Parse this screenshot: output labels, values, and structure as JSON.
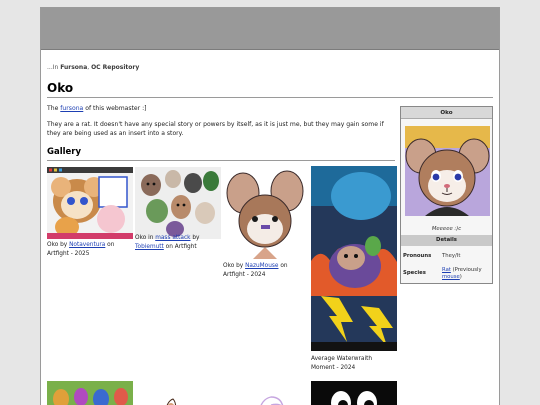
{
  "breadcrumb": {
    "prefix": "...In ",
    "link1": "Fursona",
    "sep": ", ",
    "link2": "OC Repository"
  },
  "page": {
    "title": "Oko",
    "intro_pre": "The ",
    "intro_link": "fursona",
    "intro_post": " of this webmaster :]",
    "description": "They are a rat. It doesn't have any special story or powers by itself, as it is just me, but they may gain some if they are being used as an insert into a story."
  },
  "gallery": {
    "heading": "Gallery",
    "items": [
      {
        "pre": "Oko by ",
        "link": "Notaventura",
        "post": " on Artfight - 2025"
      },
      {
        "pre": "Oko in ",
        "link": "mass attack",
        "mid": " by ",
        "link2": "Tobiemutt",
        "post": " on Artfight"
      },
      {
        "pre": "Oko by ",
        "link": "NazuMouse",
        "post": " on Artfight - 2024"
      },
      {
        "pre": "Average Waterwraith Moment - 2024"
      }
    ]
  },
  "infobox": {
    "title": "Oko",
    "caption": "Meeeee :)c",
    "details_heading": "Details",
    "pronouns_label": "Pronouns",
    "pronouns_value": "They/It",
    "species_label": "Species",
    "species_link": "Rat",
    "species_note": " (Previously ",
    "species_link2": "mouse",
    "species_end": ")"
  },
  "colors": {
    "link": "#1d3fb3",
    "header_bar": "#999999",
    "page_bg": "#e6e6e6"
  }
}
